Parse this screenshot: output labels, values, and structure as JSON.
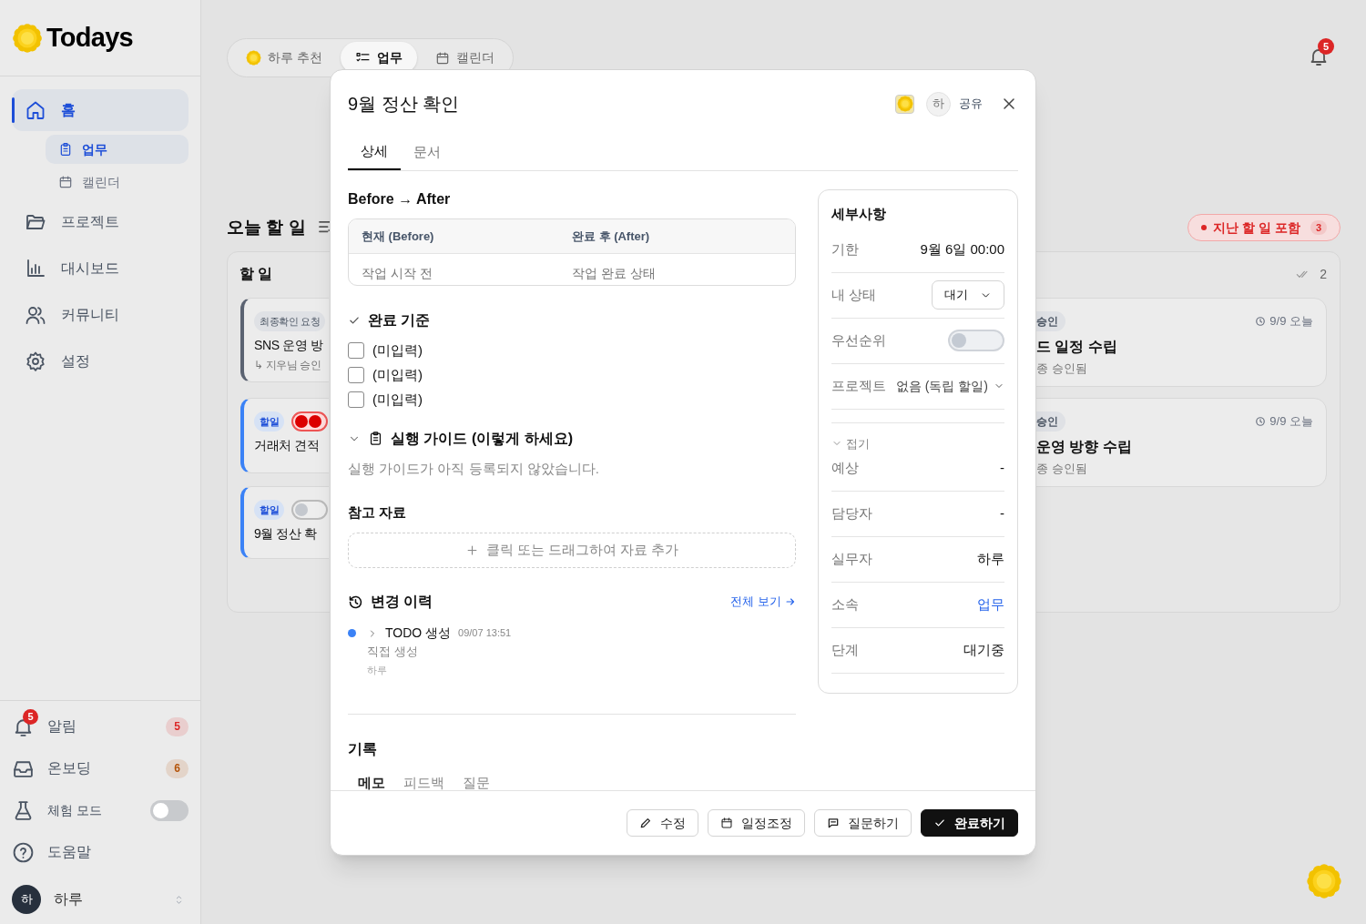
{
  "app": {
    "name": "Todays"
  },
  "sidebar": {
    "nav": [
      {
        "label": "홈",
        "selected": true,
        "children": [
          {
            "label": "업무",
            "selected": true
          },
          {
            "label": "캘린더",
            "selected": false
          }
        ]
      },
      {
        "label": "프로젝트",
        "selected": false
      },
      {
        "label": "대시보드",
        "selected": false
      },
      {
        "label": "커뮤니티",
        "selected": false
      },
      {
        "label": "설정",
        "selected": false
      }
    ],
    "bottom": [
      {
        "kind": "count",
        "label": "알림",
        "badge": "5",
        "count": "5",
        "color": "#dc2626"
      },
      {
        "kind": "count",
        "label": "온보딩",
        "count": "6",
        "color": "#b45309"
      },
      {
        "kind": "toggle",
        "label": "체험 모드",
        "on": false
      },
      {
        "kind": "link",
        "label": "도움말"
      }
    ],
    "user": {
      "avatar": "하",
      "name": "하루"
    }
  },
  "view_tabs": [
    {
      "label": "하루 추천",
      "selected": false
    },
    {
      "label": "업무",
      "selected": true
    },
    {
      "label": "캘린더",
      "selected": false
    }
  ],
  "notifications": {
    "badge": "5"
  },
  "board": {
    "title": "오늘 할 일",
    "filter": {
      "label": "지난 할 일 포함",
      "count": "3"
    },
    "todo": {
      "title": "할 일",
      "cards": [
        {
          "kind": "review",
          "badge": "최종확인 요청",
          "title": "SNS 운영 방",
          "subtitle": "↳ 지우님 승인"
        },
        {
          "kind": "task",
          "badge": "할일",
          "urgent": true,
          "title": "거래처 견적"
        },
        {
          "kind": "task",
          "badge": "할일",
          "urgent": false,
          "title": "9월 정산 확"
        }
      ]
    },
    "done": {
      "count": "2",
      "cards": [
        {
          "badge": "승인",
          "due": "9/9 오늘",
          "title": "드 일정 수립",
          "subtitle": "종 승인됨"
        },
        {
          "badge": "승인",
          "due": "9/9 오늘",
          "title": "운영 방향 수립",
          "subtitle": "종 승인됨"
        }
      ]
    }
  },
  "modal": {
    "title": "9월 정산 확인",
    "avatar": "하",
    "share": "공유",
    "tabs": [
      {
        "label": "상세",
        "selected": true
      },
      {
        "label": "문서",
        "selected": false
      }
    ],
    "before_after": {
      "title": "Before → After",
      "columns": [
        "현재 (Before)",
        "완료 후 (After)"
      ],
      "row": [
        "작업 시작 전",
        "작업 완료 상태"
      ]
    },
    "criteria": {
      "title": "완료 기준",
      "items": [
        {
          "label": "(미입력)",
          "checked": false
        },
        {
          "label": "(미입력)",
          "checked": false
        },
        {
          "label": "(미입력)",
          "checked": false
        }
      ]
    },
    "guide": {
      "title": "실행 가이드 (이렇게 하세요)",
      "expanded": true,
      "empty": "실행 가이드가 아직 등록되지 않았습니다."
    },
    "references": {
      "title": "참고 자료",
      "drop": "클릭 또는 드래그하여 자료 추가"
    },
    "history": {
      "title": "변경 이력",
      "link": "전체 보기",
      "entries": [
        {
          "title": "TODO 생성",
          "time": "09/07 13:51",
          "detail": "직접 생성",
          "by": "하루",
          "color": "#3b82f6"
        }
      ]
    },
    "records": {
      "title": "기록",
      "tabs": [
        {
          "label": "메모",
          "selected": true
        },
        {
          "label": "피드백",
          "selected": false
        },
        {
          "label": "질문",
          "selected": false
        }
      ]
    },
    "details": {
      "title": "세부사항",
      "rows": [
        {
          "kind": "text",
          "label": "기한",
          "value": "9월 6일 00:00"
        },
        {
          "kind": "select",
          "label": "내 상태",
          "value": "대기"
        },
        {
          "kind": "toggle",
          "label": "우선순위",
          "on": false
        },
        {
          "kind": "dropdown",
          "label": "프로젝트",
          "value": "없음 (독립 할일)"
        }
      ],
      "fold": {
        "label": "접기",
        "expanded": true
      },
      "more_rows": [
        {
          "kind": "text",
          "label": "예상",
          "value": "-"
        },
        {
          "kind": "text",
          "label": "담당자",
          "value": "-"
        },
        {
          "kind": "text",
          "label": "실무자",
          "value": "하루"
        },
        {
          "kind": "link",
          "label": "소속",
          "value": "업무"
        },
        {
          "kind": "text",
          "label": "단계",
          "value": "대기중"
        }
      ]
    },
    "buttons": [
      {
        "label": "수정",
        "primary": false
      },
      {
        "label": "일정조정",
        "primary": false
      },
      {
        "label": "질문하기",
        "primary": false
      },
      {
        "label": "완료하기",
        "primary": true
      }
    ]
  }
}
